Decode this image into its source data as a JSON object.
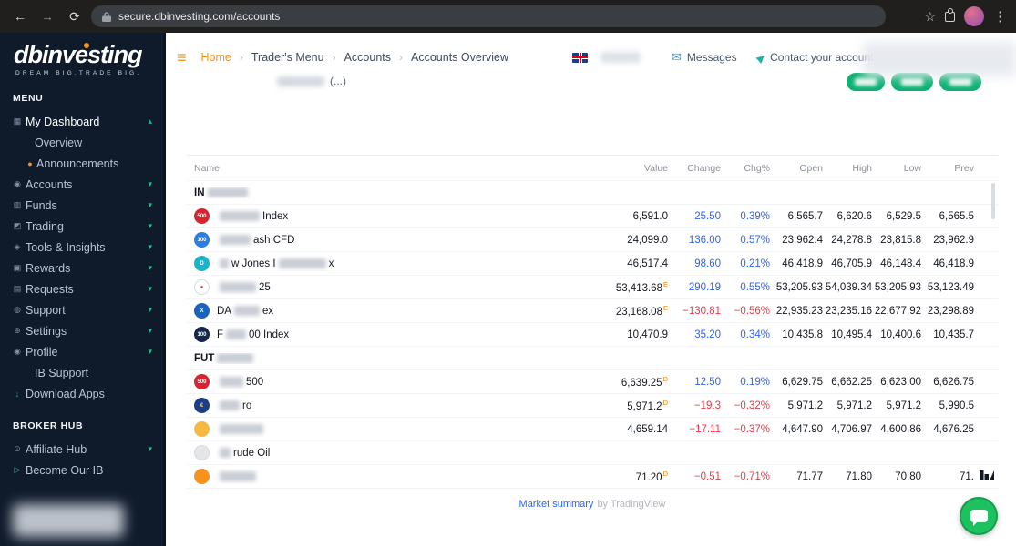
{
  "browser": {
    "url": "secure.dbinvesting.com/accounts"
  },
  "brand": {
    "logo": "dbinvesting",
    "tagline": "DREAM BIG.TRADE BIG."
  },
  "sidebar": {
    "menu_label": "MENU",
    "broker_label": "BROKER HUB",
    "menu": [
      {
        "label": "My Dashboard",
        "icon": "dashboard",
        "chevron": "up",
        "active": true
      },
      {
        "label": "Overview",
        "indent": true
      },
      {
        "label": "Announcements",
        "indent": true,
        "icon": "announcement",
        "iconColor": "#f7941d"
      },
      {
        "label": "Accounts",
        "icon": "accounts",
        "chevron": "down"
      },
      {
        "label": "Funds",
        "icon": "funds",
        "chevron": "down"
      },
      {
        "label": "Trading",
        "icon": "trading",
        "chevron": "down"
      },
      {
        "label": "Tools & Insights",
        "icon": "tools",
        "chevron": "down"
      },
      {
        "label": "Rewards",
        "icon": "rewards",
        "chevron": "down"
      },
      {
        "label": "Requests",
        "icon": "requests",
        "chevron": "down"
      },
      {
        "label": "Support",
        "icon": "support",
        "chevron": "down"
      },
      {
        "label": "Settings",
        "icon": "settings",
        "chevron": "down"
      },
      {
        "label": "Profile",
        "icon": "profile",
        "chevron": "down"
      },
      {
        "label": "IB Support",
        "indent": true
      },
      {
        "label": "Download Apps",
        "icon": "download",
        "iconColor": "#1ab5a3"
      }
    ],
    "broker": [
      {
        "label": "Affiliate Hub",
        "icon": "affiliate",
        "chevron": "down"
      },
      {
        "label": "Become Our IB",
        "icon": "speaker",
        "iconColor": "#1ab5a3"
      }
    ]
  },
  "header": {
    "breadcrumbs": [
      "Home",
      "Trader's Menu",
      "Accounts",
      "Accounts Overview"
    ],
    "messages_label": "Messages",
    "contact_label": "Contact your account manager"
  },
  "page": {
    "title_suffix": "(...)"
  },
  "market": {
    "columns": [
      "Name",
      "Value",
      "Change",
      "Chg%",
      "Open",
      "High",
      "Low",
      "Prev"
    ],
    "footer_link": "Market summary",
    "footer_suffix": "by TradingView",
    "colors": {
      "up": "#2962ff",
      "down": "#f23645",
      "flag": "#f57c00"
    },
    "groups": [
      {
        "label": [
          {
            "text": "IN"
          },
          {
            "blur": 44
          }
        ],
        "rows": [
          {
            "icon": {
              "bg": "#d9232e",
              "fg": "#ffffff",
              "glyph": "500"
            },
            "name": [
              {
                "blur": 44
              },
              {
                "text": "Index"
              }
            ],
            "value": "6,591.0",
            "flag": "",
            "change": "25.50",
            "chg": "0.39%",
            "dir": "up",
            "open": "6,565.7",
            "high": "6,620.6",
            "low": "6,529.5",
            "prev": "6,565.5"
          },
          {
            "icon": {
              "bg": "#2a7de1",
              "fg": "#ffffff",
              "glyph": "100"
            },
            "name": [
              {
                "blur": 34
              },
              {
                "text": "ash CFD"
              }
            ],
            "value": "24,099.0",
            "flag": "",
            "change": "136.00",
            "chg": "0.57%",
            "dir": "up",
            "open": "23,962.4",
            "high": "24,278.8",
            "low": "23,815.8",
            "prev": "23,962.9"
          },
          {
            "icon": {
              "bg": "#19b5cf",
              "fg": "#ffffff",
              "glyph": "D"
            },
            "name": [
              {
                "blur": 10
              },
              {
                "text": "w Jones I"
              },
              {
                "blur": 52
              },
              {
                "text": "x"
              }
            ],
            "value": "46,517.4",
            "flag": "",
            "change": "98.60",
            "chg": "0.21%",
            "dir": "up",
            "open": "46,418.9",
            "high": "46,705.9",
            "low": "46,148.4",
            "prev": "46,418.9"
          },
          {
            "icon": {
              "bg": "#ffffff",
              "fg": "#e53935",
              "glyph": "●",
              "border": "#d8dbe0"
            },
            "name": [
              {
                "blur": 40
              },
              {
                "text": "25"
              }
            ],
            "value": "53,413.68",
            "flag": "E",
            "change": "290.19",
            "chg": "0.55%",
            "dir": "up",
            "open": "53,205.93",
            "high": "54,039.34",
            "low": "53,205.93",
            "prev": "53,123.49"
          },
          {
            "icon": {
              "bg": "#1565c0",
              "fg": "#ffffff",
              "glyph": "X"
            },
            "name": [
              {
                "text": "DA"
              },
              {
                "blur": 28
              },
              {
                "text": "ex"
              }
            ],
            "value": "23,168.08",
            "flag": "E",
            "change": "−130.81",
            "chg": "−0.56%",
            "dir": "down",
            "open": "22,935.23",
            "high": "23,235.16",
            "low": "22,677.92",
            "prev": "23,298.89"
          },
          {
            "icon": {
              "bg": "#16264c",
              "fg": "#ffffff",
              "glyph": "100"
            },
            "name": [
              {
                "text": "F"
              },
              {
                "blur": 22
              },
              {
                "text": "00 Index"
              }
            ],
            "value": "10,470.9",
            "flag": "",
            "change": "35.20",
            "chg": "0.34%",
            "dir": "up",
            "open": "10,435.8",
            "high": "10,495.4",
            "low": "10,400.6",
            "prev": "10,435.7"
          }
        ]
      },
      {
        "label": [
          {
            "text": "FUT"
          },
          {
            "blur": 40
          }
        ],
        "rows": [
          {
            "icon": {
              "bg": "#d9232e",
              "fg": "#ffffff",
              "glyph": "500"
            },
            "name": [
              {
                "blur": 26
              },
              {
                "text": "500"
              }
            ],
            "value": "6,639.25",
            "flag": "D",
            "change": "12.50",
            "chg": "0.19%",
            "dir": "up",
            "open": "6,629.75",
            "high": "6,662.25",
            "low": "6,623.00",
            "prev": "6,626.75"
          },
          {
            "icon": {
              "bg": "#1a3e8c",
              "fg": "#ffd24d",
              "glyph": "€"
            },
            "name": [
              {
                "blur": 22
              },
              {
                "text": "ro"
              }
            ],
            "value": "5,971.2",
            "flag": "D",
            "change": "−19.3",
            "chg": "−0.32%",
            "dir": "down",
            "open": "5,971.2",
            "high": "5,971.2",
            "low": "5,971.2",
            "prev": "5,990.5"
          },
          {
            "icon": {
              "bg": "#f5b942",
              "fg": "#ffffff",
              "glyph": ""
            },
            "name": [
              {
                "blur": 48
              }
            ],
            "value": "4,659.14",
            "flag": "",
            "change": "−17.11",
            "chg": "−0.37%",
            "dir": "down",
            "open": "4,647.90",
            "high": "4,706.97",
            "low": "4,600.86",
            "prev": "4,676.25"
          },
          {
            "icon": {
              "bg": "#e4e6ea",
              "fg": "#9aa0a6",
              "glyph": "",
              "border": "#d8dbe0"
            },
            "name": [
              {
                "blur": 12
              },
              {
                "text": "rude Oil"
              }
            ],
            "value": "",
            "flag": "",
            "change": "",
            "chg": "",
            "dir": "flat",
            "open": "",
            "high": "",
            "low": "",
            "prev": ""
          },
          {
            "icon": {
              "bg": "#f7931a",
              "fg": "#ffffff",
              "glyph": ""
            },
            "name": [
              {
                "blur": 40
              }
            ],
            "value": "71.20",
            "flag": "D",
            "change": "−0.51",
            "chg": "−0.71%",
            "dir": "down",
            "open": "71.77",
            "high": "71.80",
            "low": "70.80",
            "prev": "71."
          }
        ]
      }
    ]
  }
}
